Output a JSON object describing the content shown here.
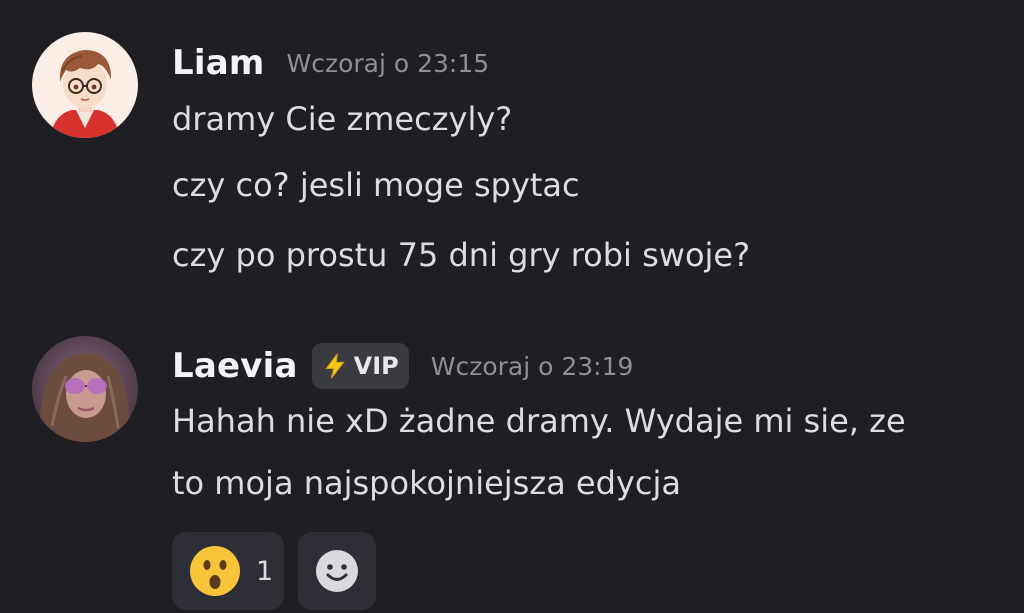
{
  "messages": [
    {
      "username": "Liam",
      "timestamp": "Wczoraj o 23:15",
      "avatar": "anime-boy-avatar",
      "lines": [
        "dramy Cie zmeczyly?",
        "czy co? jesli moge spytac",
        "czy po prostu 75 dni gry robi swoje?"
      ]
    },
    {
      "username": "Laevia",
      "badge": {
        "icon": "lightning-icon",
        "label": "VIP"
      },
      "timestamp": "Wczoraj o 23:19",
      "avatar": "photo-avatar",
      "lines": [
        "Hahah nie xD żadne dramy. Wydaje mi sie, ze",
        "to moja najspokojniejsza edycja"
      ],
      "reactions": [
        {
          "emoji": "surprised-face-emoji",
          "count": "1"
        }
      ],
      "add_reaction_icon": "smiley-face-icon"
    }
  ],
  "colors": {
    "background": "#1e1e23",
    "text": "#dcdde1",
    "timestamp": "#8e9097",
    "reaction_bg": "#2e2f36",
    "badge_bg": "#3a3b41"
  }
}
